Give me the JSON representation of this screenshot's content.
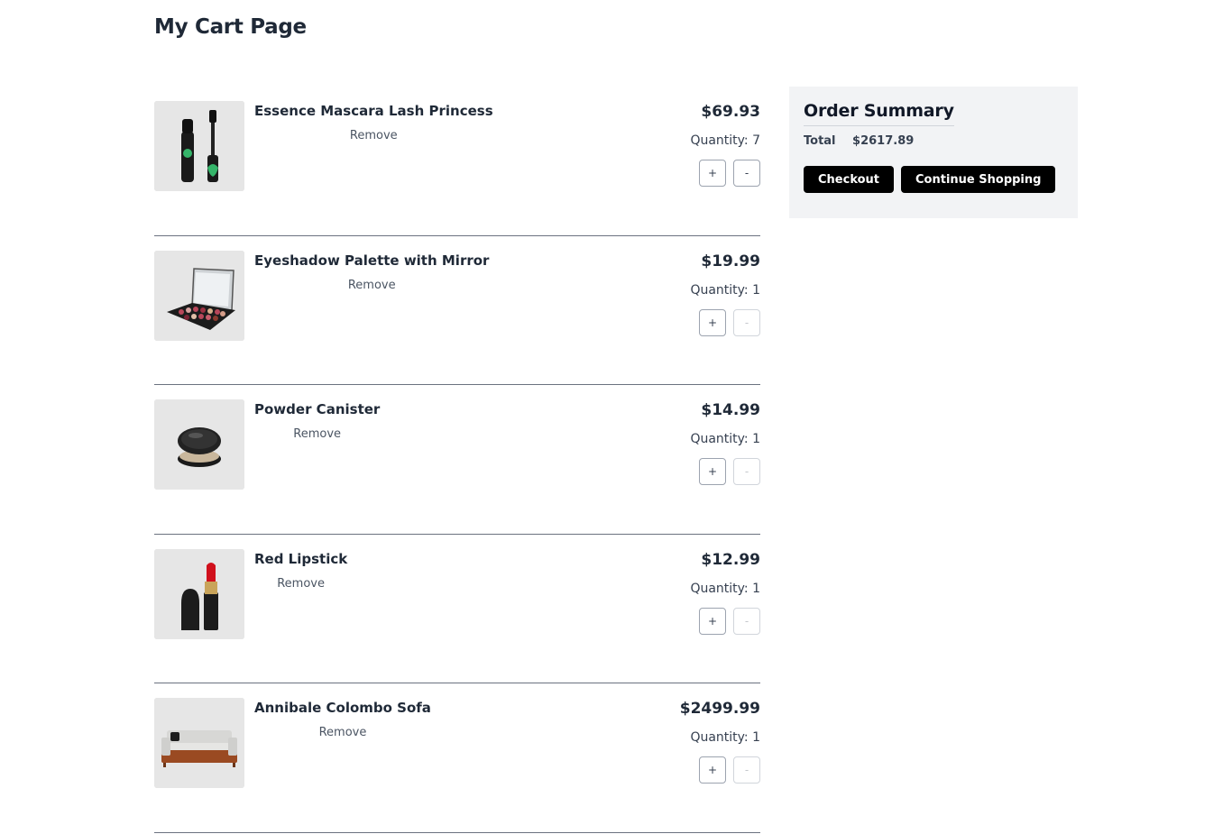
{
  "page": {
    "title": "My Cart Page"
  },
  "cart": {
    "remove_label": "Remove",
    "quantity_prefix": "Quantity: ",
    "increase_label": "+",
    "decrease_label": "-",
    "items": [
      {
        "name": "Essence Mascara Lash Princess",
        "price": "$69.93",
        "quantity": "Quantity: 7",
        "image_icon": "mascara-image"
      },
      {
        "name": "Eyeshadow Palette with Mirror",
        "price": "$19.99",
        "quantity": "Quantity: 1",
        "image_icon": "eyeshadow-palette-image"
      },
      {
        "name": "Powder Canister",
        "price": "$14.99",
        "quantity": "Quantity: 1",
        "image_icon": "powder-canister-image"
      },
      {
        "name": "Red Lipstick",
        "price": "$12.99",
        "quantity": "Quantity: 1",
        "image_icon": "lipstick-image"
      },
      {
        "name": "Annibale Colombo Sofa",
        "price": "$2499.99",
        "quantity": "Quantity: 1",
        "image_icon": "sofa-image"
      }
    ]
  },
  "summary": {
    "title": "Order Summary",
    "total_label": "Total",
    "total_value": "$2617.89",
    "checkout_label": "Checkout",
    "continue_label": "Continue Shopping"
  },
  "colors": {
    "summary_bg": "#f2f3f5",
    "primary_button": "#000000",
    "divider": "#6b7280"
  }
}
